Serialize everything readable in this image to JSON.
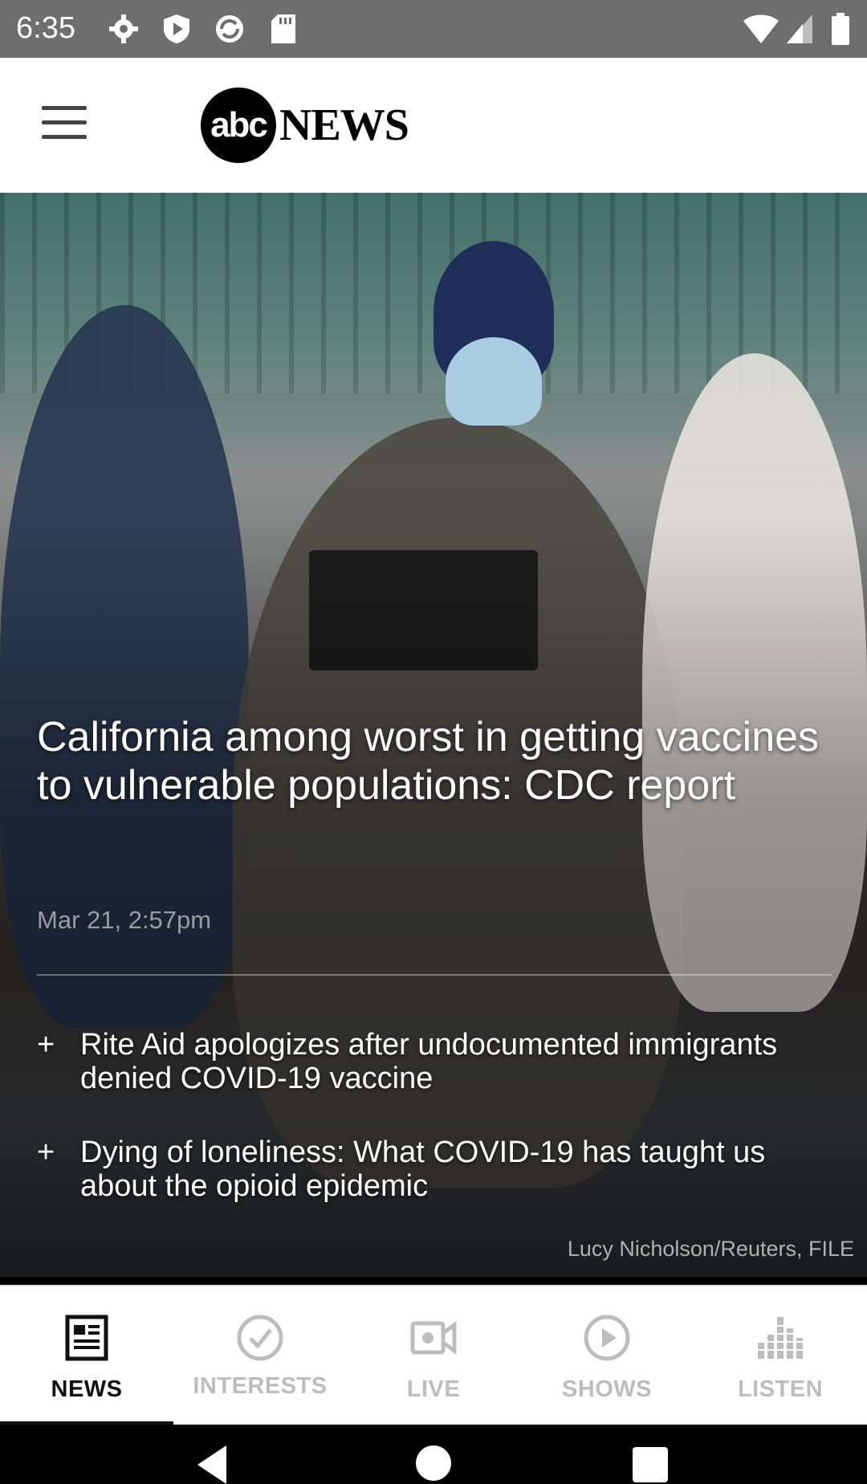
{
  "status_bar": {
    "time": "6:35",
    "icons": [
      "gear-icon",
      "shield-play-icon",
      "sync-icon",
      "sd-card-icon",
      "wifi-icon",
      "signal-icon",
      "battery-icon"
    ]
  },
  "header": {
    "menu_icon": "hamburger-icon",
    "logo_circle": "abc",
    "logo_word": "NEWS"
  },
  "hero": {
    "title": "California among worst in getting vaccines to vulnerable populations: CDC report",
    "date": "Mar 21, 2:57pm",
    "related": [
      {
        "text": "Rite Aid apologizes after undocumented immigrants denied COVID-19 vaccine"
      },
      {
        "text": "Dying of loneliness: What COVID-19 has taught us about the opioid epidemic"
      }
    ],
    "photo_credit": "Lucy Nicholson/Reuters, FILE"
  },
  "bottom_nav": {
    "tabs": [
      {
        "label": "NEWS",
        "icon": "news-icon",
        "active": true
      },
      {
        "label": "INTERESTS",
        "icon": "checkmark-circle-icon",
        "active": false
      },
      {
        "label": "LIVE",
        "icon": "video-camera-icon",
        "active": false
      },
      {
        "label": "SHOWS",
        "icon": "play-circle-icon",
        "active": false
      },
      {
        "label": "LISTEN",
        "icon": "audio-bars-icon",
        "active": false
      }
    ]
  },
  "colors": {
    "status_bar": "#6e6e6e",
    "nav_active": "#111111",
    "nav_inactive": "#bdbdbd"
  }
}
